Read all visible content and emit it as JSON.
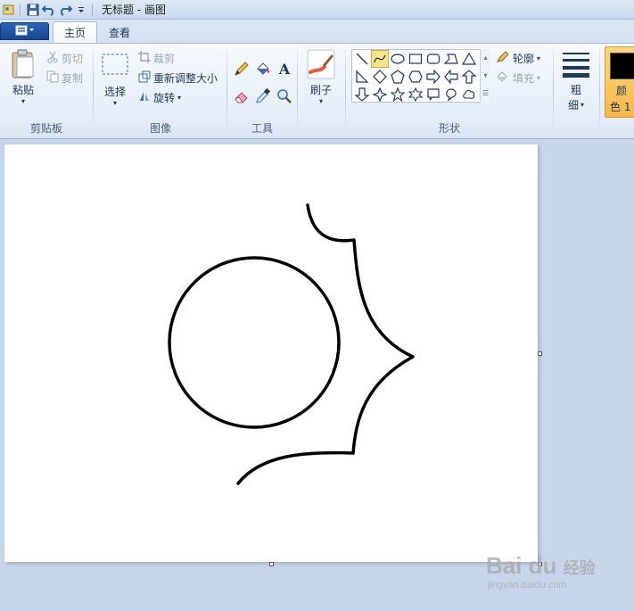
{
  "window": {
    "title": "无标题 - 画图"
  },
  "quick_access": {
    "icons": [
      "app-icon",
      "save-icon",
      "undo-icon",
      "redo-icon",
      "customize-arrow-icon"
    ]
  },
  "tabs": {
    "file_menu_icon": "menu-icon",
    "home": "主页",
    "view": "查看"
  },
  "clipboard": {
    "paste": "粘贴",
    "cut": "剪切",
    "copy": "复制",
    "label": "剪贴板"
  },
  "image": {
    "select": "选择",
    "crop": "裁剪",
    "resize": "重新调整大小",
    "rotate": "旋转",
    "label": "图像"
  },
  "tools": {
    "icons": [
      "pencil-icon",
      "fill-icon",
      "text-icon",
      "eraser-icon",
      "color-picker-icon",
      "magnifier-icon"
    ],
    "label": "工具"
  },
  "brushes": {
    "label": "刷子"
  },
  "shapes": {
    "outline": "轮廓",
    "fill": "填充",
    "label": "形状"
  },
  "size": {
    "label_line1": "粗",
    "label_line2": "细"
  },
  "colors": {
    "color1_line1": "颜",
    "color1_line2": "色 1",
    "color1_value": "#000000",
    "accent": "#f6b748"
  },
  "watermark": {
    "logo": "Bai du",
    "text": "经验",
    "url": "jingyan.baidu.com"
  }
}
